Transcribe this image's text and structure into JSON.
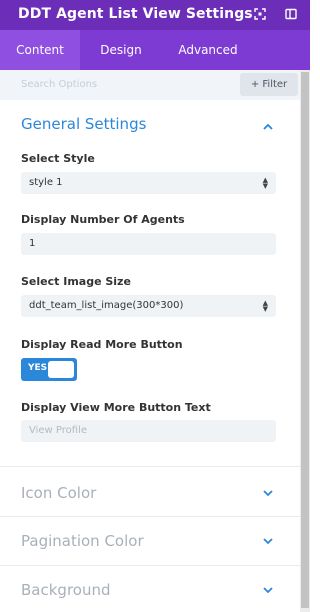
{
  "header": {
    "title": "DDT Agent List View Settings",
    "icons": [
      "expand-icon",
      "sidebar-toggle-icon"
    ]
  },
  "tabs": [
    {
      "label": "Content",
      "active": true
    },
    {
      "label": "Design",
      "active": false
    },
    {
      "label": "Advanced",
      "active": false
    }
  ],
  "search": {
    "placeholder": "Search Options",
    "filter_label": "+ Filter"
  },
  "general": {
    "title": "General Settings",
    "expanded": true,
    "select_style": {
      "label": "Select Style",
      "value": "style 1"
    },
    "number_of_agents": {
      "label": "Display Number Of Agents",
      "value": "1"
    },
    "image_size": {
      "label": "Select Image Size",
      "value": "ddt_team_list_image(300*300)"
    },
    "read_more": {
      "label": "Display Read More Button",
      "toggle_text": "YES",
      "on": true
    },
    "view_more_text": {
      "label": "Display View More Button Text",
      "placeholder": "View Profile"
    }
  },
  "collapsed_sections": [
    {
      "title": "Icon Color"
    },
    {
      "title": "Pagination Color"
    },
    {
      "title": "Background"
    }
  ],
  "colors": {
    "header_bg": "#6c2eb9",
    "tabs_bg": "#7d3bd4",
    "active_tab_bg": "#8f4fe0",
    "accent": "#2b87da"
  }
}
